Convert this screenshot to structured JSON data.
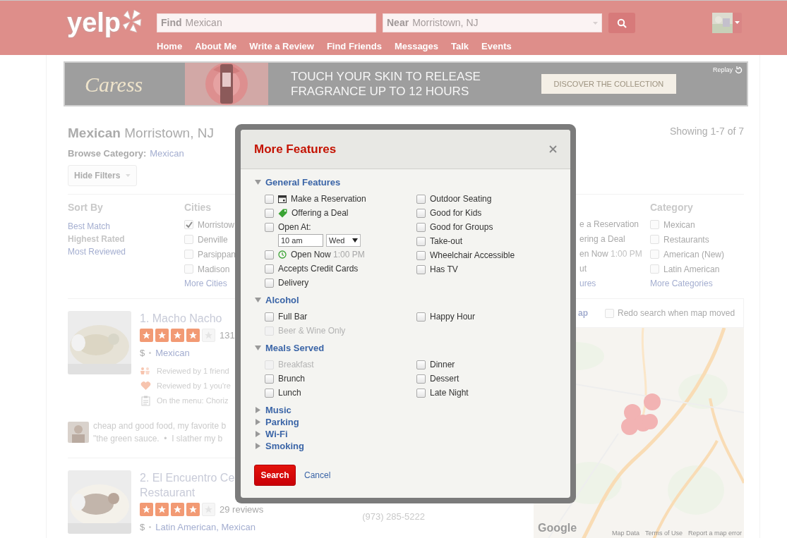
{
  "header": {
    "logo": "yelp",
    "find": {
      "label": "Find",
      "value": "Mexican"
    },
    "near": {
      "label": "Near",
      "value": "Morristown, NJ"
    },
    "nav": [
      "Home",
      "About Me",
      "Write a Review",
      "Find Friends",
      "Messages",
      "Talk",
      "Events"
    ]
  },
  "ad": {
    "logo": "Caress",
    "headline": [
      "TOUCH YOUR SKIN TO RELEASE",
      "FRAGRANCE UP TO 12 HOURS"
    ],
    "cta": "DISCOVER THE COLLECTION",
    "replay": "Replay"
  },
  "results_header": {
    "title": "Mexican",
    "location": "Morristown, NJ",
    "browse_label": "Browse Category:",
    "browse_link": "Mexican",
    "hide_filters": "Hide Filters",
    "showing": "Showing 1-7 of 7"
  },
  "filters": {
    "sort_by": {
      "title": "Sort By",
      "options": [
        {
          "label": "Best Match",
          "selected": false
        },
        {
          "label": "Highest Rated",
          "selected": true
        },
        {
          "label": "Most Reviewed",
          "selected": false
        }
      ]
    },
    "cities": {
      "title": "Cities",
      "items": [
        {
          "label": "Morristow",
          "checked": true
        },
        {
          "label": "Denville",
          "checked": false
        },
        {
          "label": "Parsippan",
          "checked": false
        },
        {
          "label": "Madison",
          "checked": false
        }
      ],
      "more": "More Cities"
    },
    "features_partial": [
      {
        "kind": "option",
        "text": "e a Reservation"
      },
      {
        "kind": "option",
        "text": "ering a Deal"
      },
      {
        "kind": "option",
        "text": "en Now",
        "note": "1:00 PM"
      },
      {
        "kind": "option",
        "text": "ut"
      },
      {
        "kind": "link",
        "text": "ures"
      }
    ],
    "category": {
      "title": "Category",
      "items": [
        {
          "label": "Mexican",
          "checked": false
        },
        {
          "label": "Restaurants",
          "checked": false
        },
        {
          "label": "American (New)",
          "checked": false
        },
        {
          "label": "Latin American",
          "checked": false
        }
      ],
      "more": "More Categories"
    }
  },
  "results": [
    {
      "title": [
        "1. Macho Nacho"
      ],
      "stars": 4,
      "reviews": "131",
      "price": "$",
      "categories": "Mexican",
      "notes": [
        {
          "kind": "friend",
          "text": "Reviewed by 1 friend"
        },
        {
          "kind": "heart",
          "text": "Reviewed by 1 you're"
        },
        {
          "kind": "menu",
          "text": "On the menu: Choriz"
        }
      ],
      "snippet": [
        "cheap and good food, my favorite b",
        "\"the green sauce.  •  I slather my b"
      ]
    },
    {
      "title": [
        "2. El Encuentro Ce",
        "Restaurant"
      ],
      "stars": 4,
      "reviews": "29 reviews",
      "price": "$",
      "categories": "Latin American, Mexican",
      "phone": "(973) 285-5222"
    }
  ],
  "map": {
    "toggle": "ap",
    "redo": {
      "label": "Redo search when map moved",
      "checked": false
    },
    "logo": "Google",
    "footer": [
      "Map Data",
      "Terms of Use",
      "Report a map error"
    ]
  },
  "modal": {
    "title": "More Features",
    "sections": [
      {
        "title": "General Features",
        "expanded": true,
        "columns": [
          [
            {
              "kind": "reservation",
              "label": "Make a Reservation",
              "checked": false,
              "disabled": false
            },
            {
              "kind": "deal",
              "label": "Offering a Deal",
              "checked": false,
              "disabled": false
            },
            {
              "kind": "open_at",
              "label": "Open At:",
              "checked": false,
              "disabled": false,
              "time": "10 am",
              "day": "Wed"
            },
            {
              "kind": "open_now",
              "label": "Open Now",
              "note": "1:00 PM",
              "checked": false,
              "disabled": false
            },
            {
              "kind": "plain",
              "label": "Accepts Credit Cards",
              "checked": false,
              "disabled": false
            },
            {
              "kind": "plain",
              "label": "Delivery",
              "checked": false,
              "disabled": false
            }
          ],
          [
            {
              "kind": "plain",
              "label": "Outdoor Seating",
              "checked": false,
              "disabled": false
            },
            {
              "kind": "plain",
              "label": "Good for Kids",
              "checked": false,
              "disabled": false
            },
            {
              "kind": "plain",
              "label": "Good for Groups",
              "checked": false,
              "disabled": false
            },
            {
              "kind": "plain",
              "label": "Take-out",
              "checked": false,
              "disabled": false
            },
            {
              "kind": "plain",
              "label": "Wheelchair Accessible",
              "checked": false,
              "disabled": false
            },
            {
              "kind": "plain",
              "label": "Has TV",
              "checked": false,
              "disabled": false
            }
          ]
        ]
      },
      {
        "title": "Alcohol",
        "expanded": true,
        "columns": [
          [
            {
              "kind": "plain",
              "label": "Full Bar",
              "checked": false,
              "disabled": false
            },
            {
              "kind": "plain",
              "label": "Beer & Wine Only",
              "checked": false,
              "disabled": true
            }
          ],
          [
            {
              "kind": "plain",
              "label": "Happy Hour",
              "checked": false,
              "disabled": false
            }
          ]
        ]
      },
      {
        "title": "Meals Served",
        "expanded": true,
        "columns": [
          [
            {
              "kind": "plain",
              "label": "Breakfast",
              "checked": false,
              "disabled": true
            },
            {
              "kind": "plain",
              "label": "Brunch",
              "checked": false,
              "disabled": false
            },
            {
              "kind": "plain",
              "label": "Lunch",
              "checked": false,
              "disabled": false
            }
          ],
          [
            {
              "kind": "plain",
              "label": "Dinner",
              "checked": false,
              "disabled": false
            },
            {
              "kind": "plain",
              "label": "Dessert",
              "checked": false,
              "disabled": false
            },
            {
              "kind": "plain",
              "label": "Late Night",
              "checked": false,
              "disabled": false
            }
          ]
        ]
      },
      {
        "title": "Music",
        "expanded": false
      },
      {
        "title": "Parking",
        "expanded": false
      },
      {
        "title": "Wi-Fi",
        "expanded": false
      },
      {
        "title": "Smoking",
        "expanded": false
      }
    ],
    "search": "Search",
    "cancel": "Cancel"
  }
}
